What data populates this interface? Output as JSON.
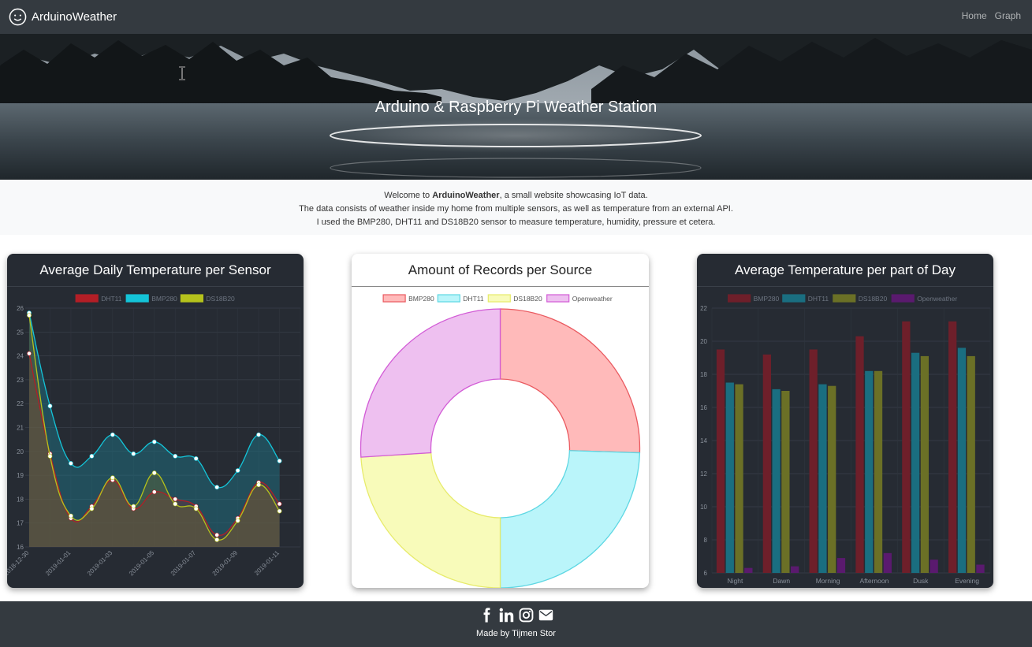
{
  "navbar": {
    "brand": "ArduinoWeather",
    "links": [
      "Home",
      "Graph"
    ]
  },
  "hero": {
    "title": "Arduino & Raspberry Pi Weather Station"
  },
  "intro": {
    "line1_pre": "Welcome to ",
    "line1_bold": "ArduinoWeather",
    "line1_post": ", a small website showcasing IoT data.",
    "line2": "The data consists of weather inside my home from multiple sensors, as well as temperature from an external API.",
    "line3": "I used the BMP280, DHT11 and DS18B20 sensor to measure temperature, humidity, pressure et cetera."
  },
  "cards": {
    "daily": {
      "title": "Average Daily Temperature per Sensor"
    },
    "records": {
      "title": "Amount of Records per Source"
    },
    "partofday": {
      "title": "Average Temperature per part of Day"
    }
  },
  "footer": {
    "made_by": "Made by",
    "author": "Tijmen Stor",
    "icons": [
      "facebook-icon",
      "linkedin-icon",
      "instagram-icon",
      "envelope-icon"
    ]
  },
  "chart_data": [
    {
      "type": "area",
      "title": "Average Daily Temperature per Sensor",
      "legend_position": "top",
      "grid": true,
      "ylim": [
        16,
        26
      ],
      "yticks": [
        16,
        17,
        18,
        19,
        20,
        21,
        22,
        23,
        24,
        25,
        26
      ],
      "x_tick_labels": [
        "2018-12-30",
        "2019-01-01",
        "2019-01-03",
        "2019-01-05",
        "2019-01-07",
        "2019-01-09",
        "2019-01-11"
      ],
      "x_count": 14,
      "series": [
        {
          "name": "DHT11",
          "color": "#b31e26",
          "values": [
            24.1,
            19.9,
            17.2,
            17.7,
            18.8,
            17.6,
            18.3,
            18.0,
            17.7,
            16.5,
            17.2,
            18.7,
            17.8,
            null
          ]
        },
        {
          "name": "BMP280",
          "color": "#14c4d8",
          "values": [
            25.8,
            21.9,
            19.5,
            19.8,
            20.7,
            19.9,
            20.4,
            19.8,
            19.7,
            18.5,
            19.2,
            20.7,
            19.6,
            null
          ]
        },
        {
          "name": "DS18B20",
          "color": "#b5c21c",
          "values": [
            25.7,
            19.8,
            17.3,
            17.6,
            18.9,
            17.7,
            19.1,
            17.8,
            17.6,
            16.3,
            17.1,
            18.6,
            17.5,
            null
          ]
        }
      ]
    },
    {
      "type": "pie",
      "title": "Amount of Records per Source",
      "legend_position": "top",
      "labels": [
        "BMP280",
        "DHT11",
        "DS18B20",
        "Openweather"
      ],
      "values": [
        25.5,
        24.5,
        24.0,
        26.0
      ],
      "fill_colors": [
        "#ffbaba",
        "#baf5fa",
        "#f8fbba",
        "#eec0f0"
      ],
      "stroke_colors": [
        "#ea5a60",
        "#5ed7e3",
        "#e7eb6b",
        "#d25bd6"
      ]
    },
    {
      "type": "bar",
      "title": "Average Temperature per part of Day",
      "legend_position": "top",
      "grid": true,
      "ylim": [
        6,
        22
      ],
      "yticks": [
        6,
        8,
        10,
        12,
        14,
        16,
        18,
        20,
        22
      ],
      "categories": [
        "Night",
        "Dawn",
        "Morning",
        "Afternoon",
        "Dusk",
        "Evening"
      ],
      "series": [
        {
          "name": "BMP280",
          "color": "#6e1f2a",
          "values": [
            19.5,
            19.2,
            19.5,
            20.3,
            21.2,
            21.2
          ]
        },
        {
          "name": "DHT11",
          "color": "#1a6e80",
          "values": [
            17.5,
            17.1,
            17.4,
            18.2,
            19.3,
            19.6
          ]
        },
        {
          "name": "DS18B20",
          "color": "#6b7026",
          "values": [
            17.4,
            17.0,
            17.3,
            18.2,
            19.1,
            19.1
          ]
        },
        {
          "name": "Openweather",
          "color": "#5a1a6e",
          "values": [
            6.3,
            6.4,
            6.9,
            7.2,
            6.8,
            6.5
          ]
        }
      ]
    }
  ]
}
